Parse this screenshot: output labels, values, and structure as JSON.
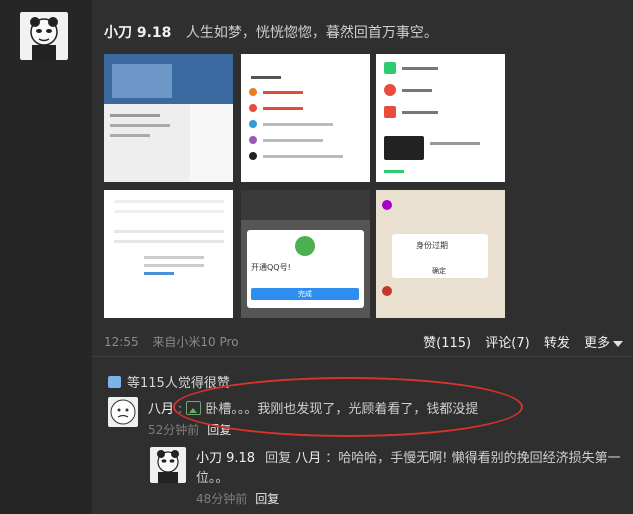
{
  "post": {
    "author": "小刀 9.18",
    "text": "人生如梦，恍恍惚惚，暮然回首万事空。",
    "time": "12:55",
    "source": "来自小米10 Pro",
    "actions": {
      "like": "赞(115)",
      "comment": "评论(7)",
      "forward": "转发",
      "more": "更多"
    }
  },
  "thumbs": {
    "t5_title": "开通QQ号!",
    "t5_btn": "完成",
    "t6_title": "身份过期",
    "t6_btn": "确定"
  },
  "likes_summary": "等115人觉得很赞",
  "comments": [
    {
      "author": "八月",
      "text": "卧槽。。。我刚也发现了，光顾着看了，钱都没提",
      "time": "52分钟前",
      "reply_label": "回复"
    },
    {
      "author": "小刀 9.18",
      "reply_word": "回复",
      "reply_to": "八月",
      "text_line1": "：哈哈哈，手慢无啊! 懒得看别的挽回经济损失第一",
      "text_line2": "位。。",
      "time": "48分钟前",
      "reply_label": "回复"
    }
  ],
  "colors": {
    "annotation": "#d9342b",
    "background": "#262626",
    "card": "#2f2f2f"
  }
}
